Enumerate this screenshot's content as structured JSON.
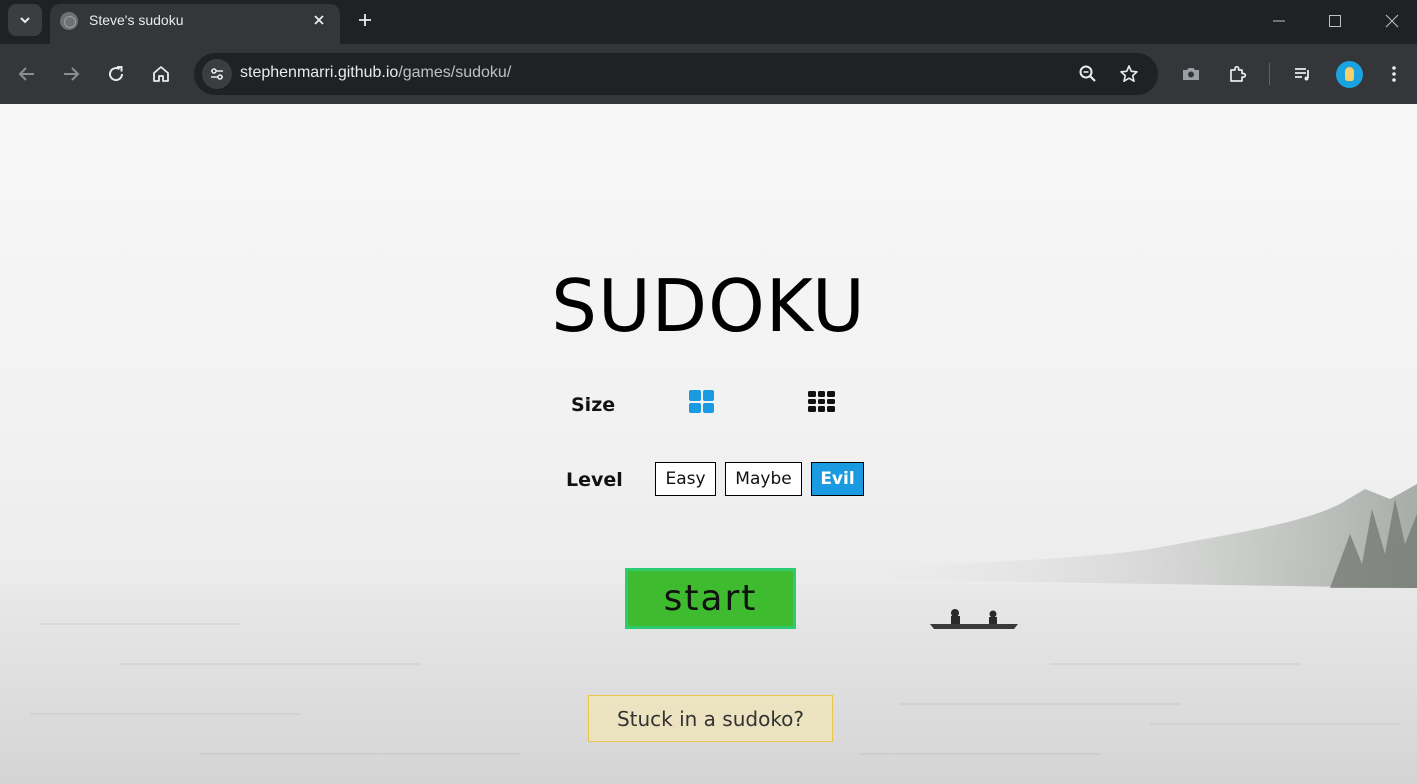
{
  "browser": {
    "tab_title": "Steve's sudoku",
    "url_host": "stephenmarri.github.io",
    "url_path": "/games/sudoku/"
  },
  "page": {
    "title": "SUDOKU",
    "size_label": "Size",
    "size_options": [
      {
        "icon": "grid-2x2-icon",
        "selected": true,
        "color": "#1a9ae0"
      },
      {
        "icon": "grid-3x3-icon",
        "selected": false,
        "color": "#111111"
      }
    ],
    "level_label": "Level",
    "levels": [
      {
        "label": "Easy",
        "selected": false
      },
      {
        "label": "Maybe",
        "selected": false
      },
      {
        "label": "Evil",
        "selected": true
      }
    ],
    "start_label": "start",
    "help_label": "Stuck in a sudoko?"
  },
  "colors": {
    "accent_blue": "#1a9ae0",
    "start_green": "#3fbb2f",
    "start_border": "#2ecc71",
    "help_border": "#e8c64a"
  }
}
